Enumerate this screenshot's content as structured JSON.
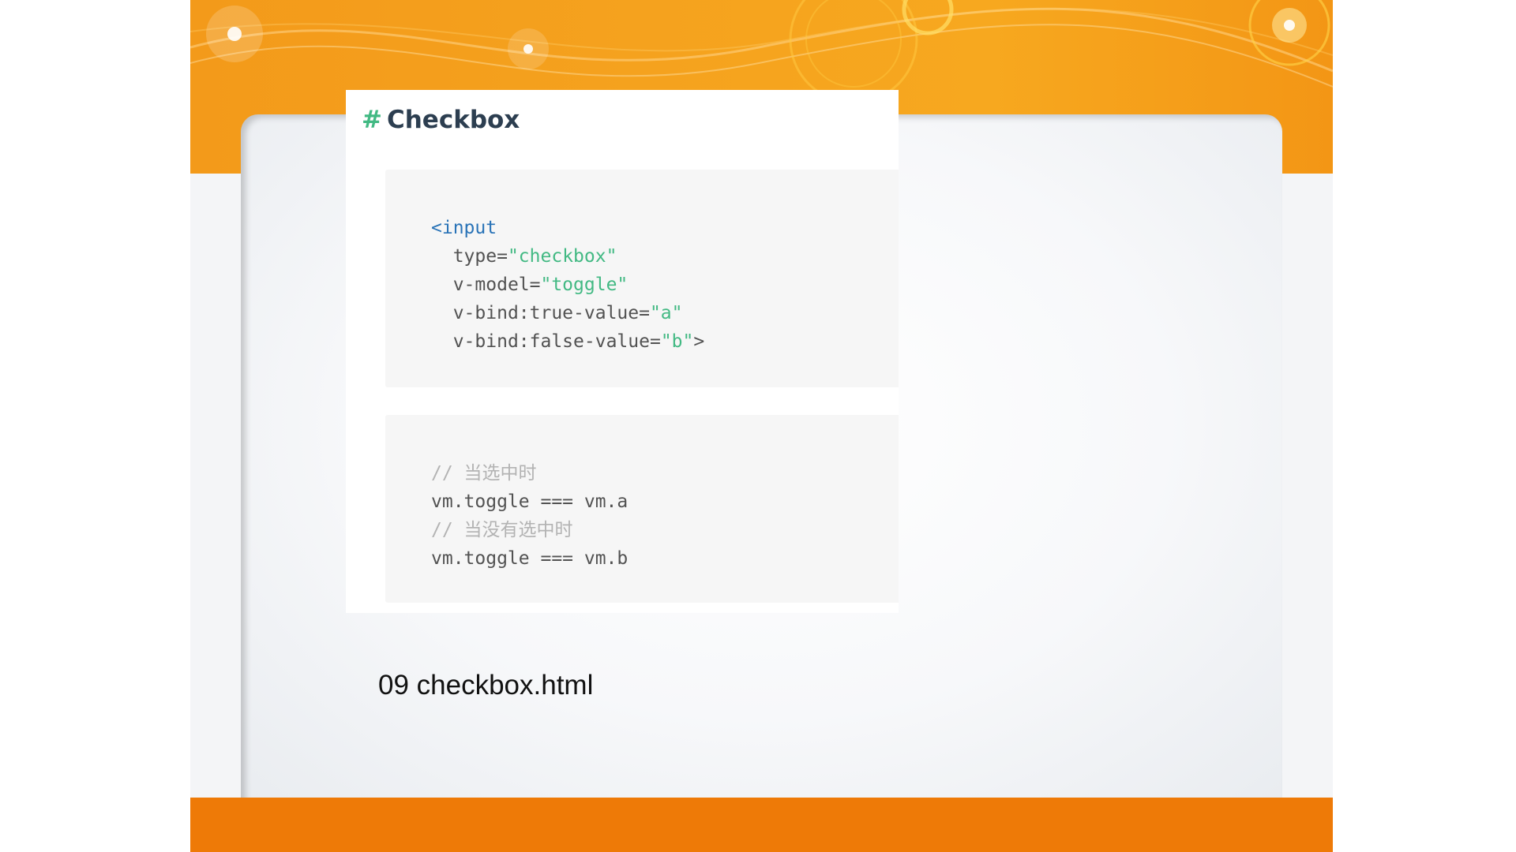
{
  "colors": {
    "orange_band": "#f5a21e",
    "orange_bottom": "#ee7a07",
    "title_text": "#2c3e50",
    "hash_accent": "#42b983",
    "code_tag": "#2973b7",
    "code_string": "#42b983",
    "code_comment": "#b3b3b3",
    "code_text": "#525252",
    "code_background": "#f6f6f6"
  },
  "doc": {
    "hash": "#",
    "title": "Checkbox",
    "code_block_1": {
      "tag_open": "<input",
      "attrs": [
        {
          "name": "type=",
          "value": "\"checkbox\"",
          "suffix": ""
        },
        {
          "name": "v-model=",
          "value": "\"toggle\"",
          "suffix": ""
        },
        {
          "name": "v-bind:true-value=",
          "value": "\"a\"",
          "suffix": ""
        },
        {
          "name": "v-bind:false-value=",
          "value": "\"b\"",
          "suffix": ">"
        }
      ]
    },
    "code_block_2": {
      "lines": [
        {
          "kind": "comment",
          "text": "// 当选中时"
        },
        {
          "kind": "code",
          "text": "vm.toggle === vm.a"
        },
        {
          "kind": "comment",
          "text": "// 当没有选中时"
        },
        {
          "kind": "code",
          "text": "vm.toggle === vm.b"
        }
      ]
    }
  },
  "caption": "09 checkbox.html"
}
